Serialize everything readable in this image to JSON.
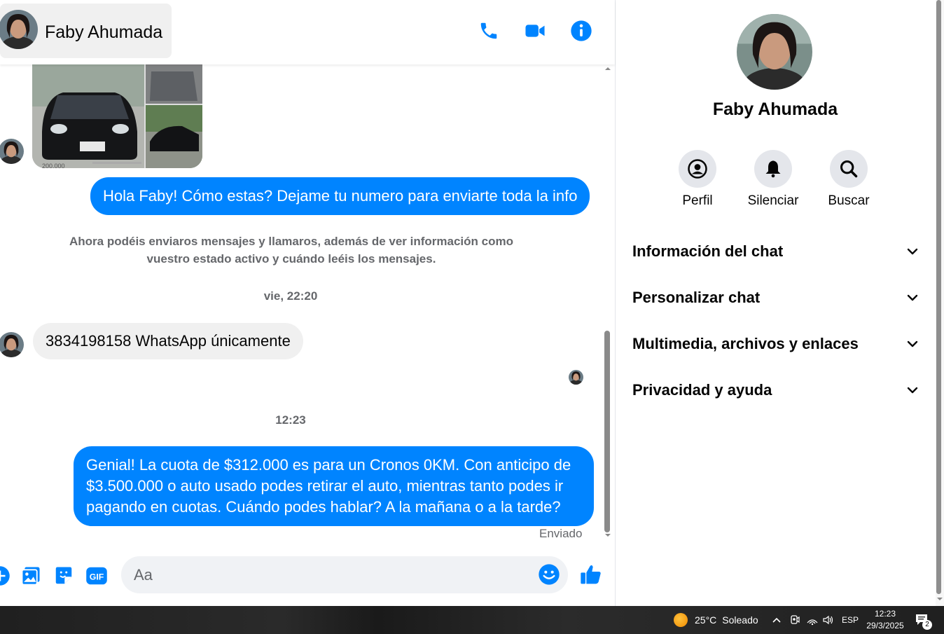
{
  "header": {
    "contact_name": "Faby Ahumada"
  },
  "messages": {
    "image_caption_partial": "200.000",
    "outgoing_1": "Hola Faby! Cómo estas? Dejame tu numero para enviarte toda la info",
    "system_notice": "Ahora podéis enviaros mensajes y llamaros, además de ver información como vuestro estado activo y cuándo leéis los mensajes.",
    "time_1": "vie, 22:20",
    "incoming_1": "3834198158 WhatsApp únicamente",
    "time_2": "12:23",
    "outgoing_2": "Genial! La cuota de $312.000 es para un Cronos 0KM. Con anticipo de $3.500.000 o auto usado podes retirar el auto, mientras tanto podes ir pagando en cuotas. Cuándo podes hablar? A la mañana o a la tarde?",
    "status": "Enviado"
  },
  "composer": {
    "placeholder": "Aa"
  },
  "info_panel": {
    "name": "Faby Ahumada",
    "actions": [
      {
        "label": "Perfil",
        "icon": "profile-icon"
      },
      {
        "label": "Silenciar",
        "icon": "bell-icon"
      },
      {
        "label": "Buscar",
        "icon": "search-icon"
      }
    ],
    "sections": [
      "Información del chat",
      "Personalizar chat",
      "Multimedia, archivos y enlaces",
      "Privacidad y ayuda"
    ]
  },
  "taskbar": {
    "weather_temp": "25°C",
    "weather_text": "Soleado",
    "language": "ESP",
    "time": "12:23",
    "date": "29/3/2025",
    "notification_count": "2"
  },
  "colors": {
    "accent": "#0084ff",
    "incoming_bubble": "#f0f0f0",
    "muted_text": "#65676b"
  }
}
